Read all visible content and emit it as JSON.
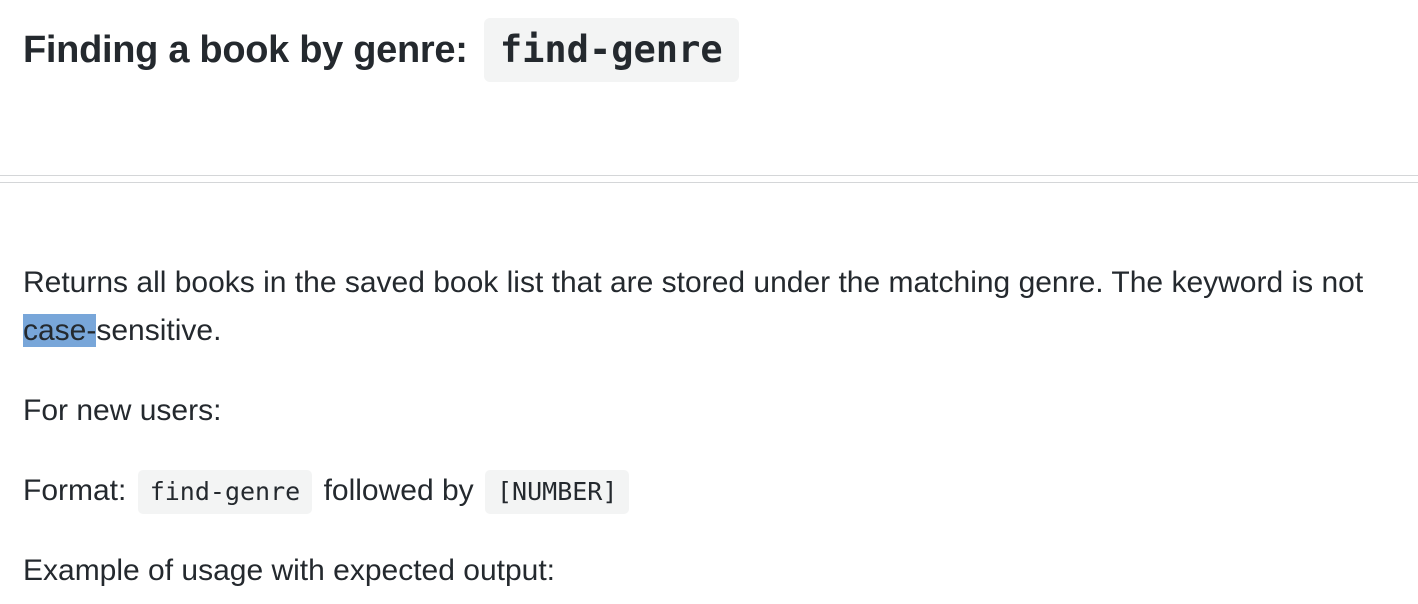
{
  "heading": {
    "text": "Finding a book by genre:",
    "code": "find-genre"
  },
  "description": {
    "part1": "Returns all books in the saved book list that are stored under the matching genre. The keyword is not ",
    "highlighted": "case-",
    "part2": "sensitive."
  },
  "new_users": "For new users:",
  "format": {
    "label": "Format:",
    "command": "find-genre",
    "middle": "followed by",
    "argument": "[NUMBER]"
  },
  "example_heading": "Example of usage with expected output:",
  "colors": {
    "selection": "#78a6d9",
    "code_background": "#f3f4f4",
    "text": "#24292e"
  }
}
